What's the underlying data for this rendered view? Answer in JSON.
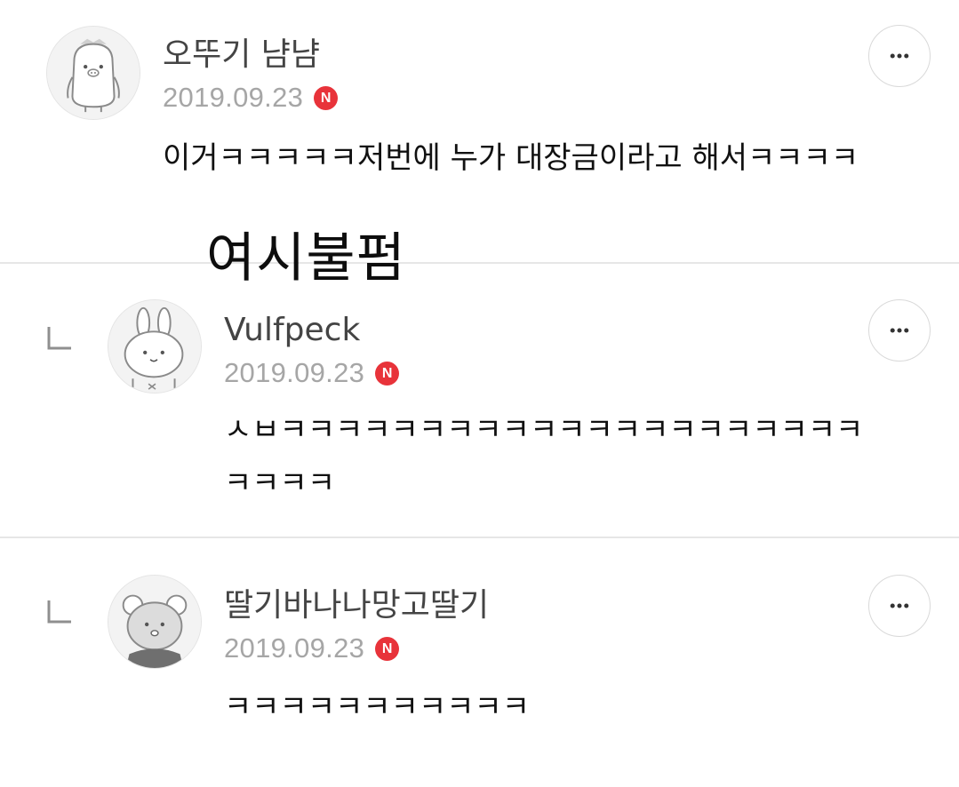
{
  "comments": [
    {
      "author": "오뚜기 냠냠",
      "date": "2019.09.23",
      "badge": "N",
      "text": "이거ㅋㅋㅋㅋㅋ저번에 누가 대장금이라고 해서ㅋㅋㅋㅋ",
      "avatar": "penguin-avatar-icon",
      "more": "more-options-icon"
    },
    {
      "author": "Vulfpeck",
      "date": "2019.09.23",
      "badge": "N",
      "text": "ㅅㅂㅋㅋㅋㅋㅋㅋㅋㅋㅋㅋㅋㅋㅋㅋㅋㅋㅋㅋㅋㅋㅋㅋㅋㅋㅋ",
      "avatar": "rabbit-avatar-icon",
      "more": "more-options-icon",
      "reply": true
    },
    {
      "author": "딸기바나나망고딸기",
      "date": "2019.09.23",
      "badge": "N",
      "text": "ㅋㅋㅋㅋㅋㅋㅋㅋㅋㅋㅋ",
      "avatar": "bear-avatar-icon",
      "more": "more-options-icon",
      "reply": true
    }
  ],
  "watermark": "여시불펌",
  "colors": {
    "badge": "#e8333a",
    "date": "#a6a6a6",
    "author": "#444444",
    "divider": "#e6e6e6"
  }
}
